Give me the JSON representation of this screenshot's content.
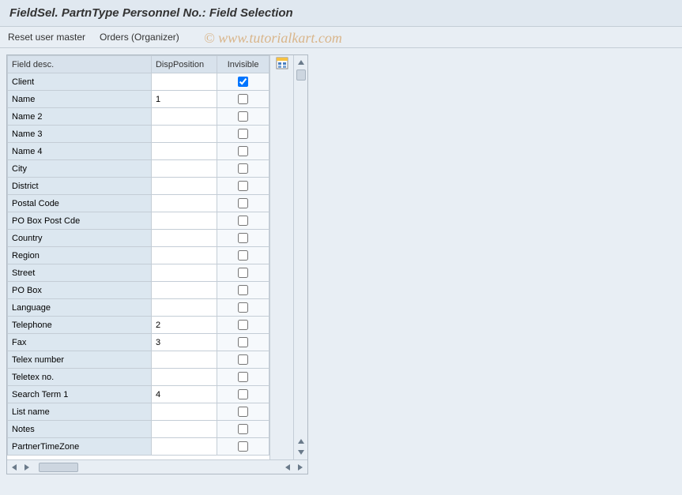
{
  "title": "FieldSel. PartnType Personnel No.: Field Selection",
  "toolbar": {
    "reset": "Reset user master",
    "orders": "Orders (Organizer)"
  },
  "watermark": "© www.tutorialkart.com",
  "table": {
    "headers": {
      "desc": "Field desc.",
      "pos": "DispPosition",
      "inv": "Invisible"
    },
    "rows": [
      {
        "desc": "Client",
        "pos": "",
        "inv": true
      },
      {
        "desc": "Name",
        "pos": "1",
        "inv": false
      },
      {
        "desc": "Name 2",
        "pos": "",
        "inv": false
      },
      {
        "desc": "Name 3",
        "pos": "",
        "inv": false
      },
      {
        "desc": "Name 4",
        "pos": "",
        "inv": false
      },
      {
        "desc": "City",
        "pos": "",
        "inv": false
      },
      {
        "desc": "District",
        "pos": "",
        "inv": false
      },
      {
        "desc": "Postal Code",
        "pos": "",
        "inv": false
      },
      {
        "desc": "PO Box Post Cde",
        "pos": "",
        "inv": false
      },
      {
        "desc": "Country",
        "pos": "",
        "inv": false
      },
      {
        "desc": "Region",
        "pos": "",
        "inv": false
      },
      {
        "desc": "Street",
        "pos": "",
        "inv": false
      },
      {
        "desc": "PO Box",
        "pos": "",
        "inv": false
      },
      {
        "desc": "Language",
        "pos": "",
        "inv": false
      },
      {
        "desc": "Telephone",
        "pos": "2",
        "inv": false
      },
      {
        "desc": "Fax",
        "pos": "3",
        "inv": false
      },
      {
        "desc": "Telex number",
        "pos": "",
        "inv": false
      },
      {
        "desc": "Teletex no.",
        "pos": "",
        "inv": false
      },
      {
        "desc": "Search Term 1",
        "pos": "4",
        "inv": false
      },
      {
        "desc": "List name",
        "pos": "",
        "inv": false
      },
      {
        "desc": "Notes",
        "pos": "",
        "inv": false
      },
      {
        "desc": "PartnerTimeZone",
        "pos": "",
        "inv": false
      }
    ]
  }
}
